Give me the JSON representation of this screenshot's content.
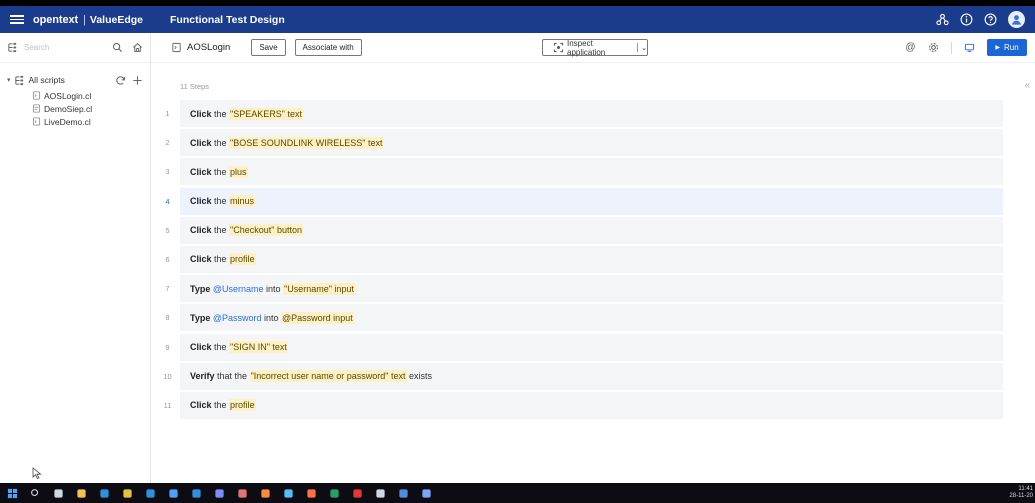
{
  "header": {
    "brand": "opentext",
    "separator": "|",
    "product": "ValueEdge",
    "app_title": "Functional Test Design",
    "icons": [
      "network-icon",
      "info-icon",
      "help-icon",
      "user-avatar-icon"
    ]
  },
  "sidebar": {
    "search_placeholder": "Search",
    "tree_header": "All scripts",
    "scripts": [
      {
        "label": "AOSLogin.cl",
        "icon": "script-icon"
      },
      {
        "label": "DemoSiep.cl",
        "icon": "script-edited-icon"
      },
      {
        "label": "LiveDemo.cl",
        "icon": "script-icon"
      }
    ]
  },
  "toolbar": {
    "script_name": "AOSLogin",
    "save_label": "Save",
    "associate_label": "Associate with",
    "inspect_label": "Inspect application",
    "run_label": "Run"
  },
  "steps_count": "11 Steps",
  "steps": [
    {
      "num": "1",
      "parts": [
        {
          "t": "Click",
          "k": "kw"
        },
        {
          "t": " the "
        },
        {
          "t": "\"SPEAKERS\" text",
          "k": "hl"
        }
      ]
    },
    {
      "num": "2",
      "parts": [
        {
          "t": "Click",
          "k": "kw"
        },
        {
          "t": " the "
        },
        {
          "t": "\"BOSE SOUNDLINK WIRELESS\" text",
          "k": "hl"
        }
      ]
    },
    {
      "num": "3",
      "parts": [
        {
          "t": "Click",
          "k": "kw"
        },
        {
          "t": " the "
        },
        {
          "t": "plus",
          "k": "hl"
        }
      ]
    },
    {
      "num": "4",
      "selected": true,
      "parts": [
        {
          "t": "Click",
          "k": "kw"
        },
        {
          "t": " the "
        },
        {
          "t": "minus",
          "k": "hl"
        }
      ]
    },
    {
      "num": "5",
      "parts": [
        {
          "t": "Click",
          "k": "kw"
        },
        {
          "t": " the "
        },
        {
          "t": "\"Checkout\" button",
          "k": "hl"
        }
      ]
    },
    {
      "num": "6",
      "parts": [
        {
          "t": "Click",
          "k": "kw"
        },
        {
          "t": " the "
        },
        {
          "t": "profile",
          "k": "hl"
        }
      ]
    },
    {
      "num": "7",
      "parts": [
        {
          "t": "Type",
          "k": "kw"
        },
        {
          "t": " "
        },
        {
          "t": "@Username",
          "k": "var"
        },
        {
          "t": " into "
        },
        {
          "t": "\"Username\" input",
          "k": "hl"
        }
      ]
    },
    {
      "num": "8",
      "parts": [
        {
          "t": "Type",
          "k": "kw"
        },
        {
          "t": " "
        },
        {
          "t": "@Password",
          "k": "var"
        },
        {
          "t": " into "
        },
        {
          "t": "@Password input",
          "k": "hl"
        }
      ]
    },
    {
      "num": "9",
      "parts": [
        {
          "t": "Click",
          "k": "kw"
        },
        {
          "t": " the "
        },
        {
          "t": "\"SIGN IN\" text",
          "k": "hl"
        }
      ]
    },
    {
      "num": "10",
      "parts": [
        {
          "t": "Verify",
          "k": "kw"
        },
        {
          "t": " that the "
        },
        {
          "t": "\"Incorrect user name or password\" text",
          "k": "hl"
        },
        {
          "t": " exists"
        }
      ]
    },
    {
      "num": "11",
      "parts": [
        {
          "t": "Click",
          "k": "kw"
        },
        {
          "t": " the "
        },
        {
          "t": "profile",
          "k": "hl"
        }
      ]
    }
  ],
  "taskbar": {
    "apps": [
      {
        "icon": "windows-start-icon",
        "color": "#4aa3ff"
      },
      {
        "icon": "search-icon",
        "color": "#cfd6e4"
      },
      {
        "icon": "task-view-icon",
        "color": "#cfd6e4"
      },
      {
        "icon": "file-explorer-icon",
        "color": "#f2c14e"
      },
      {
        "icon": "edge-icon",
        "color": "#2f8fe0"
      },
      {
        "icon": "chrome-icon",
        "color": "#e8c23a"
      },
      {
        "icon": "app-icon",
        "color": "#2f8fe0"
      },
      {
        "icon": "app-icon",
        "color": "#4aa3ff"
      },
      {
        "icon": "app-icon",
        "color": "#2f8fe0"
      },
      {
        "icon": "app-icon",
        "color": "#7b8cff"
      },
      {
        "icon": "app-icon",
        "color": "#e57373"
      },
      {
        "icon": "firefox-icon",
        "color": "#ff8c3a"
      },
      {
        "icon": "app-icon",
        "color": "#4fc3f7"
      },
      {
        "icon": "app-icon",
        "color": "#ff7043"
      },
      {
        "icon": "excel-icon",
        "color": "#21a366"
      },
      {
        "icon": "app-icon",
        "color": "#e53935"
      },
      {
        "icon": "app-icon",
        "color": "#cfd6e4"
      },
      {
        "icon": "app-icon",
        "color": "#4a90e2"
      },
      {
        "icon": "app-icon",
        "color": "#7da3ff"
      }
    ],
    "time": "11:41",
    "date": "28-11-20"
  },
  "colors": {
    "header_bg": "#1b3b8c",
    "accent": "#1a66d9",
    "highlight": "#fdf0c4",
    "step_bg": "#f4f5f7",
    "selected_step_bg": "#edf2fc"
  }
}
